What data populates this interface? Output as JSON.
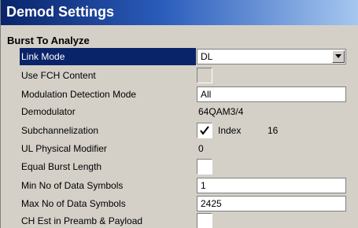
{
  "window": {
    "title": "Demod Settings"
  },
  "section": {
    "heading": "Burst To Analyze"
  },
  "fields": {
    "link_mode": {
      "label": "Link Mode",
      "value": "DL"
    },
    "use_fch_content": {
      "label": "Use FCH Content",
      "checked": false
    },
    "modulation_detection_mode": {
      "label": "Modulation Detection Mode",
      "value": "All"
    },
    "demodulator": {
      "label": "Demodulator",
      "value": "64QAM3/4"
    },
    "subchannelization": {
      "label": "Subchannelization",
      "checked": true,
      "index_label": "Index",
      "index_value": "16"
    },
    "ul_physical_modifier": {
      "label": "UL Physical Modifier",
      "value": "0"
    },
    "equal_burst_length": {
      "label": "Equal Burst Length",
      "checked": false
    },
    "min_data_symbols": {
      "label": "Min No of Data Symbols",
      "value": "1"
    },
    "max_data_symbols": {
      "label": "Max No of Data Symbols",
      "value": "2425"
    },
    "ch_est_preamb_payload": {
      "label": "CH Est in Preamb & Payload",
      "checked": false
    }
  },
  "colors": {
    "title_gradient_start": "#0a246a",
    "title_gradient_end": "#a6c8f0",
    "selection": "#0a246a",
    "face": "#d4d0c8"
  }
}
